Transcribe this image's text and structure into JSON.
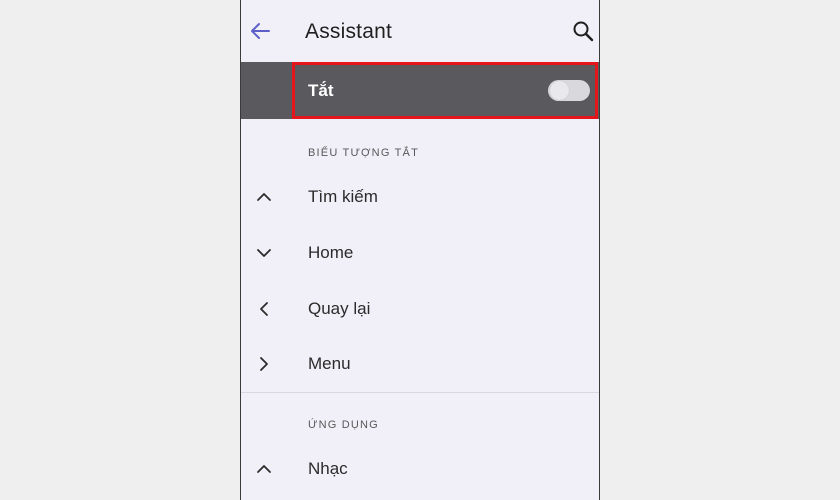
{
  "header": {
    "title": "Assistant",
    "back_icon": "arrow-left-icon",
    "search_icon": "search-icon",
    "accent_color": "#5c5fc8"
  },
  "master_switch": {
    "label": "Tắt",
    "state": "off",
    "highlight_color": "#e3161c"
  },
  "sections": [
    {
      "header": "BIỂU TƯỢNG TẮT",
      "items": [
        {
          "label": "Tìm kiếm",
          "icon": "chevron-up-icon"
        },
        {
          "label": "Home",
          "icon": "chevron-down-icon"
        },
        {
          "label": "Quay lại",
          "icon": "chevron-left-icon"
        },
        {
          "label": "Menu",
          "icon": "chevron-right-icon"
        }
      ]
    },
    {
      "header": "ỨNG DỤNG",
      "items": [
        {
          "label": "Nhạc",
          "icon": "chevron-up-icon"
        }
      ]
    }
  ]
}
